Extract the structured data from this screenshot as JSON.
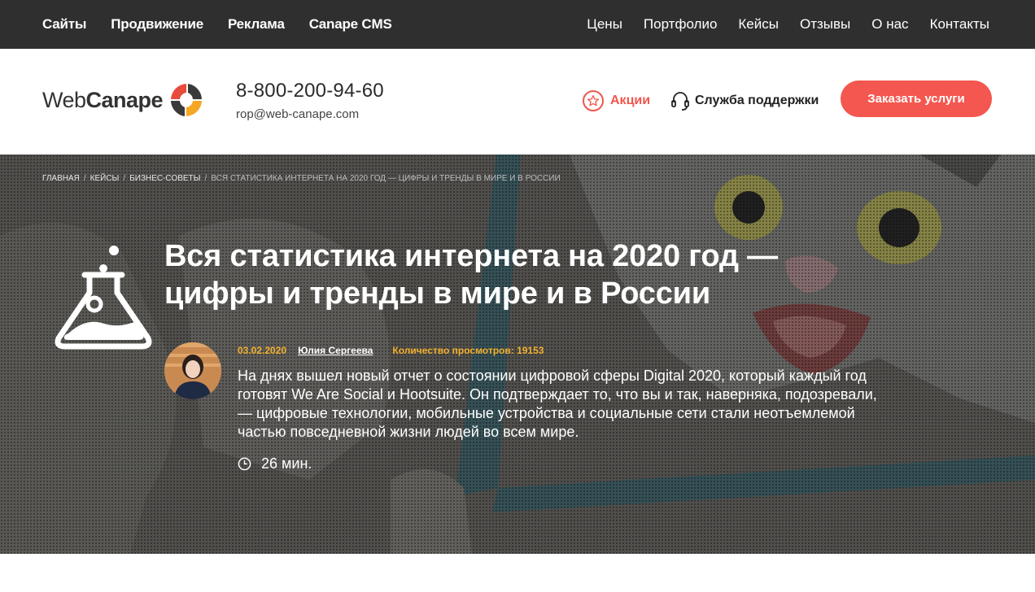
{
  "topnav": {
    "left": [
      "Сайты",
      "Продвижение",
      "Реклама",
      "Canape CMS"
    ],
    "right": [
      "Цены",
      "Портфолио",
      "Кейсы",
      "Отзывы",
      "О нас",
      "Контакты"
    ]
  },
  "header": {
    "logo_light": "Web",
    "logo_bold": "Canape",
    "phone": "8-800-200-94-60",
    "email": "rop@web-canape.com",
    "promo_label": "Акции",
    "support_label": "Служба поддержки",
    "order_button": "Заказать услуги"
  },
  "breadcrumb": {
    "items": [
      "Главная",
      "Кейсы",
      "Бизнес-советы"
    ],
    "separator": "/",
    "current": "Вся статистика интернета на 2020 год — цифры и тренды в мире и в России"
  },
  "article": {
    "title_line1": "Вся статистика интернета на 2020 год —",
    "title_line2": "цифры и тренды в мире и в России",
    "date": "03.02.2020",
    "author": "Юлия Сергеева",
    "views": "Количество просмотров: 19153",
    "lead": "На днях вышел новый отчет о состоянии цифровой сферы Digital 2020, который каждый год готовят We Are Social и Hootsuite. Он подтверждает то, что вы и так, наверняка, подозревали, — цифровые технологии, мобильные устройства и социальные сети стали неотъемлемой частью повседневной жизни людей во всем мире.",
    "read_time": "26 мин."
  },
  "colors": {
    "accent": "#f4574f",
    "meta_highlight": "#f3b02f",
    "topnav_bg": "#2f2f2f"
  },
  "icons": {
    "promo": "star-icon",
    "support": "headset-icon",
    "category": "flask-icon",
    "read_time": "clock-icon"
  }
}
